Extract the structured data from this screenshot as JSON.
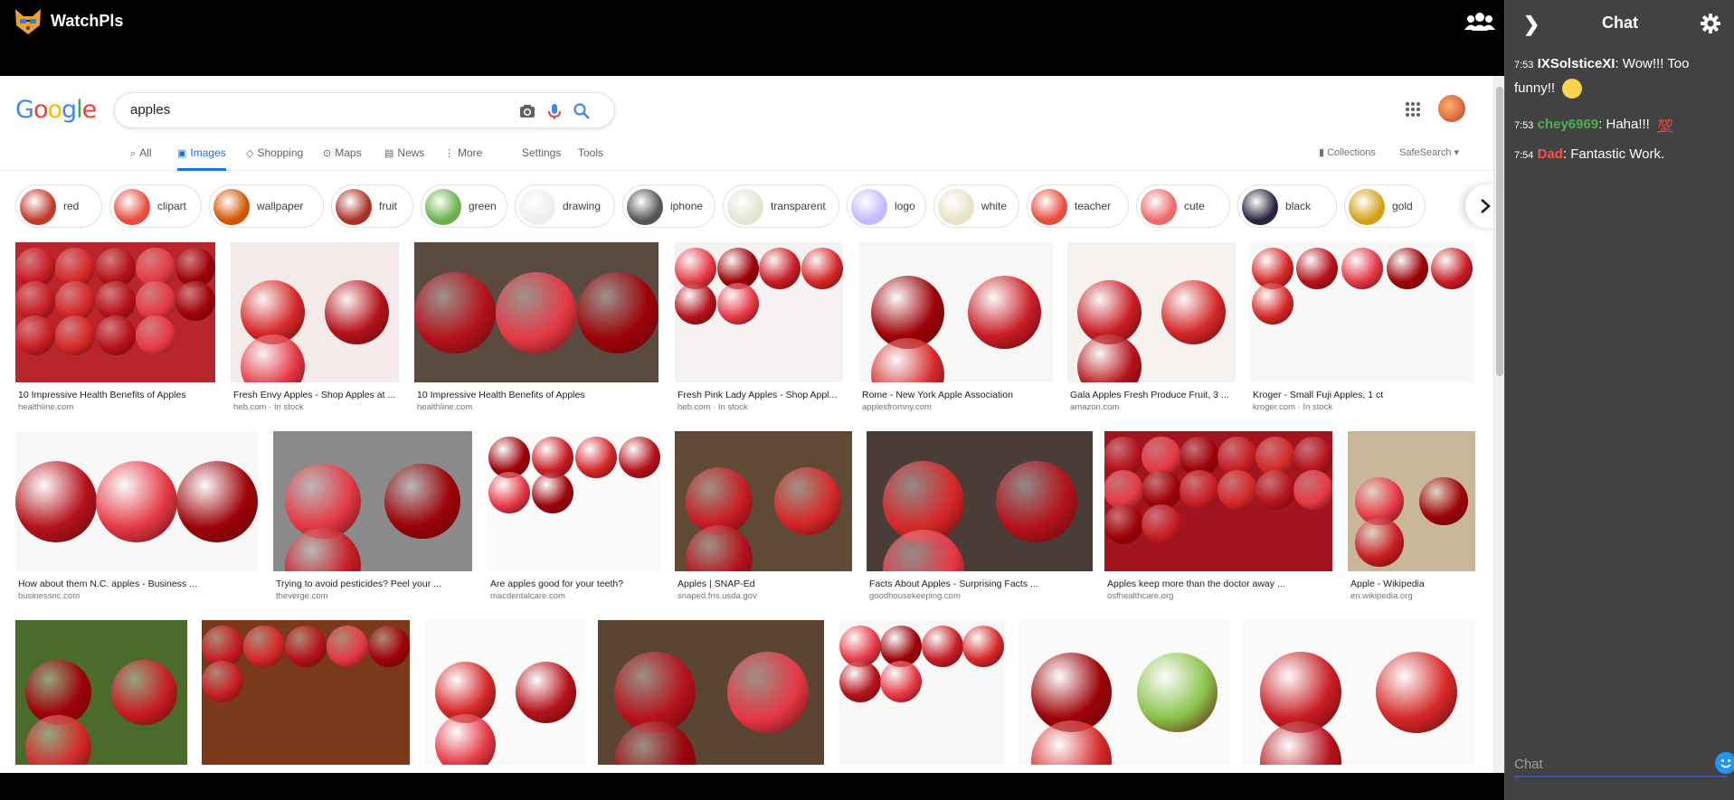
{
  "app": {
    "name": "WatchPls"
  },
  "google": {
    "logo_text": "Google",
    "logo_colors": [
      "#4285f4",
      "#ea4335",
      "#fbbc05",
      "#4285f4",
      "#34a853",
      "#ea4335"
    ],
    "search_value": "apples",
    "tabs": [
      {
        "label": "All",
        "icon": "search-icon",
        "active": false
      },
      {
        "label": "Images",
        "icon": "image-icon",
        "active": true
      },
      {
        "label": "Shopping",
        "icon": "tag-icon",
        "active": false
      },
      {
        "label": "Maps",
        "icon": "map-pin-icon",
        "active": false
      },
      {
        "label": "News",
        "icon": "news-icon",
        "active": false
      },
      {
        "label": "More",
        "icon": "more-vert-icon",
        "active": false
      }
    ],
    "settings_label": "Settings",
    "tools_label": "Tools",
    "collections_label": "Collections",
    "safesearch_label": "SafeSearch"
  },
  "chips": [
    {
      "label": "red",
      "color": "#c0392b"
    },
    {
      "label": "clipart",
      "color": "#e74c3c"
    },
    {
      "label": "wallpaper",
      "color": "#d35400"
    },
    {
      "label": "fruit",
      "color": "#a93226"
    },
    {
      "label": "green",
      "color": "#6ab04c"
    },
    {
      "label": "drawing",
      "color": "#eeeeee"
    },
    {
      "label": "iphone",
      "color": "#555555"
    },
    {
      "label": "transparent",
      "color": "#dfe6d2"
    },
    {
      "label": "logo",
      "color": "#c7b8ff"
    },
    {
      "label": "white",
      "color": "#e8e2c8"
    },
    {
      "label": "teacher",
      "color": "#e74c3c"
    },
    {
      "label": "cute",
      "color": "#ec6a6a"
    },
    {
      "label": "black",
      "color": "#2c2340"
    },
    {
      "label": "gold",
      "color": "#d4a017"
    }
  ],
  "results": [
    {
      "caption": "10 Impressive Health Benefits of Apples",
      "source": "healthline.com",
      "bg": "#b8252a"
    },
    {
      "caption": "Fresh Envy Apples - Shop Apples at ...",
      "source": "heb.com · In stock",
      "bg": "#f3eaea"
    },
    {
      "caption": "10 Impressive Health Benefits of Apples",
      "source": "healthline.com",
      "bg": "#5a4a40"
    },
    {
      "caption": "Fresh Pink Lady Apples - Shop Appl...",
      "source": "heb.com · In stock",
      "bg": "#f7f2f2"
    },
    {
      "caption": "Rome - New York Apple Association",
      "source": "applesfromny.com",
      "bg": "#f7f7f7"
    },
    {
      "caption": "Gala Apples Fresh Produce Fruit, 3 ...",
      "source": "amazon.com",
      "bg": "#f5f2f0"
    },
    {
      "caption": "Kroger - Small Fuji Apples, 1 ct",
      "source": "kroger.com · In stock",
      "bg": "#f8f8f8"
    },
    {
      "caption": "How about them N.C. apples - Business ...",
      "source": "businessnc.com",
      "bg": "#f7f7f7"
    },
    {
      "caption": "Trying to avoid pesticides? Peel your ...",
      "source": "theverge.com",
      "bg": "#8a8a8a"
    },
    {
      "caption": "Are apples good for your teeth?",
      "source": "macdentalcare.com",
      "bg": "#fafafa"
    },
    {
      "caption": "Apples | SNAP-Ed",
      "source": "snaped.fns.usda.gov",
      "bg": "#5f4a36"
    },
    {
      "caption": "Facts About Apples - Surprising Facts ...",
      "source": "goodhousekeeping.com",
      "bg": "#4a3c38"
    },
    {
      "caption": "Apples keep more than the doctor away ...",
      "source": "osfhealthcare.org",
      "bg": "#a3151e"
    },
    {
      "caption": "Apple - Wikipedia",
      "source": "en.wikipedia.org",
      "bg": "#c9b79a"
    },
    {
      "caption": "",
      "source": "",
      "bg": "#4b6b2b"
    },
    {
      "caption": "",
      "source": "",
      "bg": "#7a3a1a"
    },
    {
      "caption": "",
      "source": "",
      "bg": "#fafafa"
    },
    {
      "caption": "",
      "source": "",
      "bg": "#5a4534"
    },
    {
      "caption": "",
      "source": "",
      "bg": "#f7f7f7"
    },
    {
      "caption": "",
      "source": "",
      "bg": "#fafafa"
    },
    {
      "caption": "",
      "source": "",
      "bg": "#fafafa"
    }
  ],
  "chat": {
    "title": "Chat",
    "input_placeholder": "Chat",
    "messages": [
      {
        "time": "7:53",
        "user": "IXSolsticeXI",
        "user_color": "#ffffff",
        "text": ": Wow!!! Too funny!!",
        "emoji": "crying-laughing-emoji"
      },
      {
        "time": "7:53",
        "user": "chey6969",
        "user_color": "#4caf50",
        "text": ": Haha!!!",
        "emoji": "hundred-emoji"
      },
      {
        "time": "7:54",
        "user": "Dad",
        "user_color": "#ef5350",
        "text": ": Fantastic Work.",
        "emoji": ""
      }
    ]
  }
}
